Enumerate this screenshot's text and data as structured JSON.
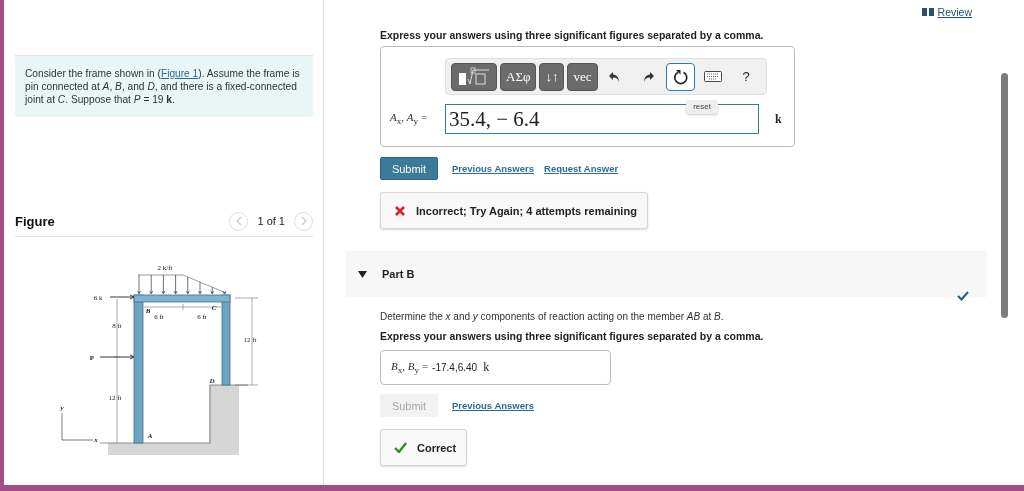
{
  "header": {
    "review_link": "Review"
  },
  "problem": {
    "before": "Consider the frame shown in (",
    "link": "Figure 1",
    "after": "). Assume the frame is pin connected at *A*, *B*, and *D*, and there is a fixed-connected joint at *C*. Suppose that *P* = 19 **k**."
  },
  "figure": {
    "title": "Figure",
    "pager": "1 of 1",
    "prev_disabled": true,
    "next_disabled": true,
    "labels": [
      "2 k/ft",
      "6 k",
      "B",
      "C",
      "6 ft",
      "6 ft",
      "8 ft",
      "P",
      "12 ft",
      "D",
      "12 ft",
      "A",
      "y",
      "x"
    ]
  },
  "part_a": {
    "instruction": "Express your answers using three significant figures separated by a comma.",
    "toolbar": [
      {
        "kind": "templates"
      },
      {
        "kind": "text",
        "label": "ΑΣφ"
      },
      {
        "kind": "text",
        "label": "↓↑"
      },
      {
        "kind": "text",
        "label": "vec"
      },
      {
        "kind": "undo"
      },
      {
        "kind": "redo"
      },
      {
        "kind": "reset",
        "selected": true
      },
      {
        "kind": "keyboard"
      },
      {
        "kind": "plain",
        "label": "?"
      }
    ],
    "tooltip": "reset",
    "answer_label": "*A*$_{x}$, *A*$_{y}$ =",
    "answer_value": "35.4, − 6.4",
    "unit": "k",
    "submit": {
      "label": "Submit",
      "disabled": false
    },
    "links": [
      "Previous Answers",
      "Request Answer"
    ],
    "feedback": {
      "kind": "incorrect",
      "text": "Incorrect; Try Again; 4 attempts remaining"
    }
  },
  "part_b": {
    "title": "Part B",
    "expanded": true,
    "completed": true,
    "question": "Determine the *x* and *y* components of reaction acting on the member *AB* at *B*.",
    "instruction": "Express your answers using three significant figures separated by a comma.",
    "answer_label": "*B*$_{x}$, *B*$_{y}$ =",
    "answer_value": "-17.4,6.40",
    "unit": "k",
    "submit": {
      "label": "Submit",
      "disabled": true
    },
    "links": [
      "Previous Answers"
    ],
    "feedback": {
      "kind": "correct",
      "text": "Correct"
    }
  }
}
